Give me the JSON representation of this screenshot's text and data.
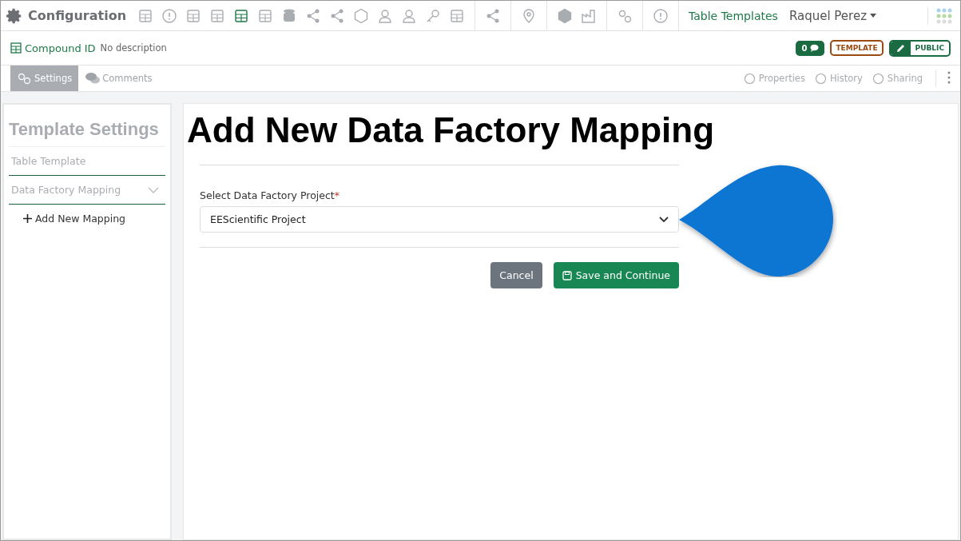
{
  "app_title": "Configuration",
  "toolbar_icons": [
    {
      "selected": false
    },
    {
      "selected": false
    },
    {
      "selected": false
    },
    {
      "selected": false
    },
    {
      "selected": true
    },
    {
      "selected": false
    },
    {
      "selected": false
    },
    {
      "selected": false
    },
    {
      "selected": false
    },
    {
      "selected": false
    },
    {
      "selected": false
    },
    {
      "selected": false
    },
    {
      "selected": false
    },
    {
      "selected": false
    },
    {
      "selected": false
    },
    {
      "selected": false
    },
    {
      "selected": false
    },
    {
      "selected": false
    },
    {
      "selected": false
    },
    {
      "selected": false
    }
  ],
  "section_link": "Table Templates",
  "user_menu": "Raquel Perez",
  "record": {
    "name": "Compound ID",
    "description": "No description",
    "comment_count": "0",
    "template_badge": "TEMPLATE",
    "visibility": "PUBLIC"
  },
  "tabs": [
    {
      "label": "Settings",
      "selected": true
    },
    {
      "label": "Comments",
      "selected": false
    }
  ],
  "actions": [
    "Properties",
    "History",
    "Sharing"
  ],
  "sidebar": {
    "title": "Template Settings",
    "items": [
      {
        "label": "Table Template"
      },
      {
        "label": "Data Factory Mapping",
        "expanded": true,
        "children": [
          {
            "label": "Add New Mapping"
          }
        ]
      }
    ]
  },
  "form": {
    "heading": "Add New Data Factory Mapping",
    "field_label": "Select Data Factory Project",
    "required_mark": "*",
    "value": "EEScientific Project",
    "buttons": [
      "Cancel",
      "Save and Continue"
    ]
  }
}
